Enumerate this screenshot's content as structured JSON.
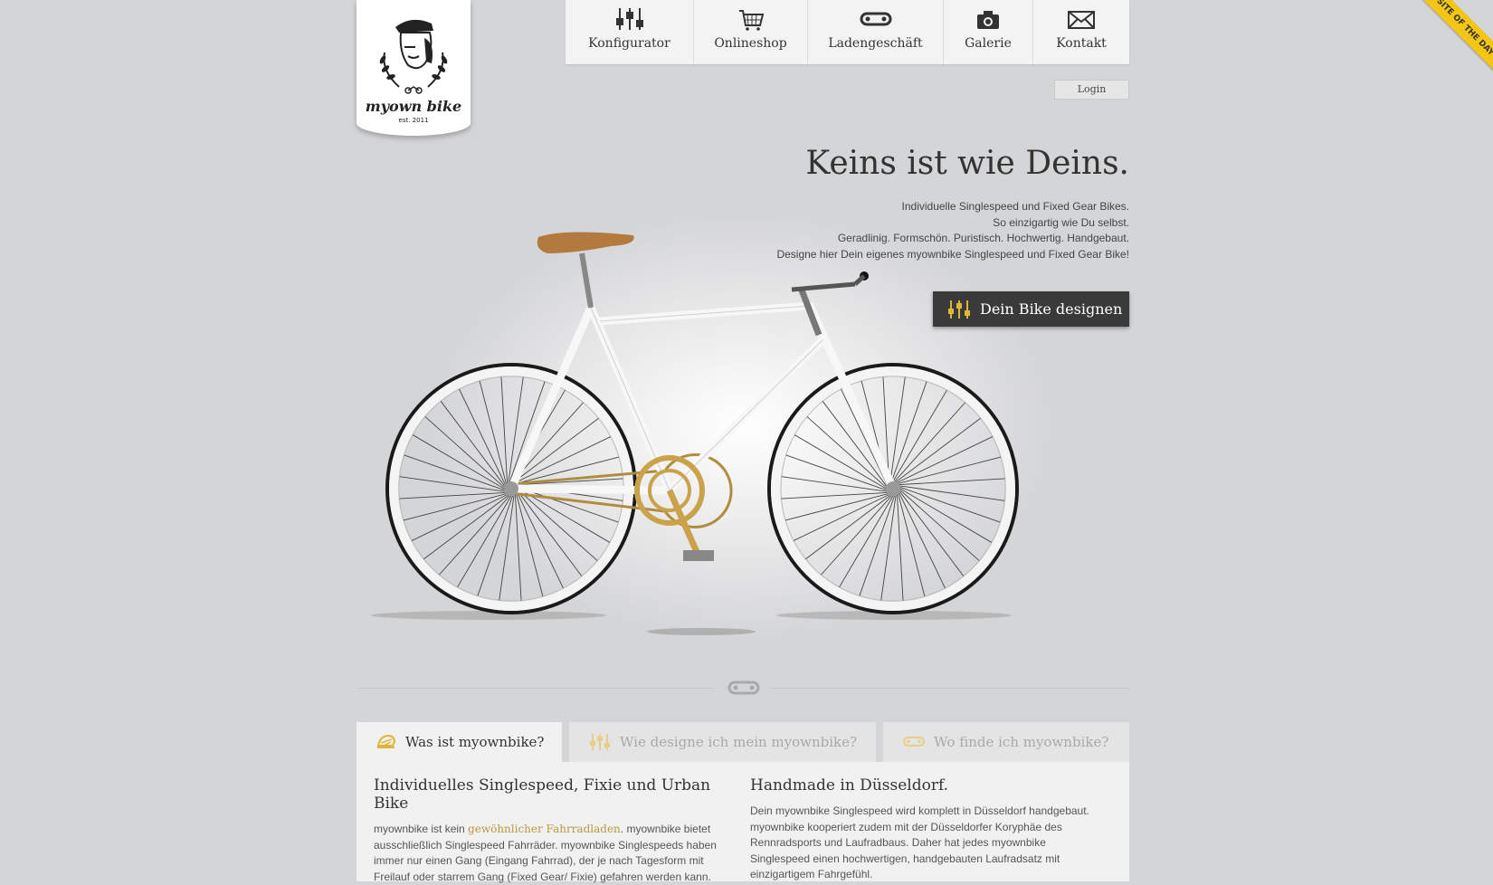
{
  "logo": {
    "name": "myown bike",
    "est": "est. 2011"
  },
  "nav": [
    {
      "label": "Konfigurator",
      "icon": "sliders-icon"
    },
    {
      "label": "Onlineshop",
      "icon": "cart-icon"
    },
    {
      "label": "Ladengeschäft",
      "icon": "chain-link-icon"
    },
    {
      "label": "Galerie",
      "icon": "camera-icon"
    },
    {
      "label": "Kontakt",
      "icon": "envelope-icon"
    }
  ],
  "login_label": "Login",
  "hero": {
    "headline": "Keins ist wie Deins.",
    "lines": [
      "Individuelle Singlespeed und Fixed Gear Bikes.",
      "So einzigartig wie Du selbst.",
      "Geradlinig. Formschön. Puristisch. Hochwertig. Handgebaut.",
      "Designe hier Dein eigenes myownbike Singlespeed und Fixed Gear Bike!"
    ],
    "cta_label": "Dein Bike designen"
  },
  "ribbon_text": "FWA SITE OF THE DAY",
  "tabs": [
    {
      "label": "Was ist myownbike?",
      "icon": "bike-helmet-icon",
      "active": true
    },
    {
      "label": "Wie designe ich mein myownbike?",
      "icon": "sliders-icon",
      "active": false
    },
    {
      "label": "Wo finde ich myownbike?",
      "icon": "chain-link-icon",
      "active": false
    }
  ],
  "content": {
    "left": {
      "title": "Individuelles Singlespeed, Fixie und Urban Bike",
      "intro": "myownbike ist kein ",
      "link": "gewöhnlicher Fahrradladen",
      "text": ". myownbike bietet ausschließlich Singlespeed Fahrräder. myownbike Singlespeeds haben immer nur einen Gang (Eingang Fahrrad), der je nach Tagesform mit Freilauf oder starrem Gang (Fixed Gear/ Fixie) gefahren werden kann."
    },
    "right": {
      "title": "Handmade in Düsseldorf.",
      "text": "Dein myownbike Singlespeed wird komplett in Düsseldorf handgebaut. myownbike kooperiert zudem mit der Düsseldorfer Koryphäe des Rennradsports und Laufradbaus. Daher hat jedes myownbike Singlespeed einen hochwertigen, handgebauten Laufradsatz mit einzigartigem Fahrgefühl."
    }
  },
  "colors": {
    "background": "#d4d5d7",
    "accent": "#b89a3e",
    "button": "#3a3a3a",
    "icon_gold": "#e0b63a"
  }
}
